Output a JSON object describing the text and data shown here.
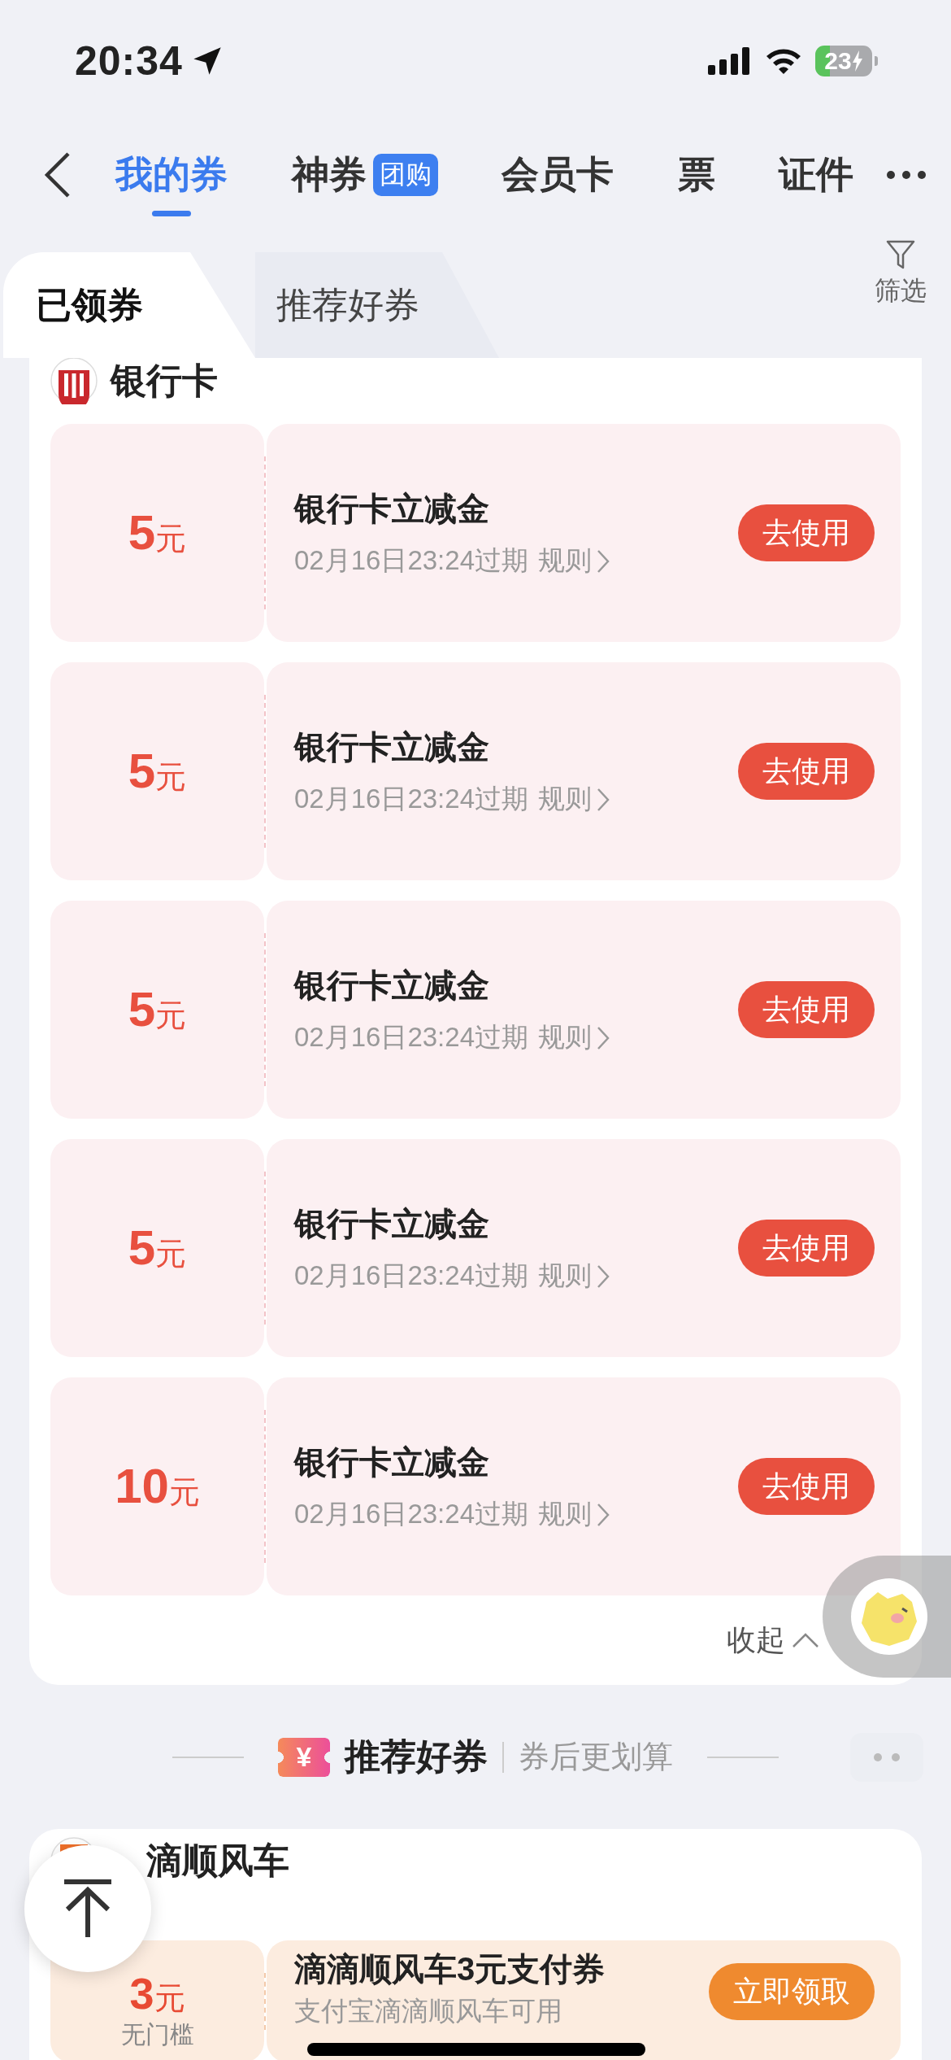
{
  "status_bar": {
    "time": "20:34",
    "battery": "23"
  },
  "nav": {
    "tabs": [
      {
        "label": "我的券",
        "selected": true
      },
      {
        "label": "神券",
        "selected": false,
        "badge": "团购"
      },
      {
        "label": "会员卡",
        "selected": false
      },
      {
        "label": "票",
        "selected": false
      },
      {
        "label": "证件",
        "selected": false
      }
    ]
  },
  "sub_tabs": {
    "tabs": [
      {
        "label": "已领券",
        "selected": true
      },
      {
        "label": "推荐好券",
        "selected": false
      }
    ],
    "filter": "筛选"
  },
  "groups": [
    {
      "name": "银行卡",
      "kind": "bank",
      "collapse": "收起",
      "coupons": [
        {
          "amount": "5",
          "unit": "元",
          "title": "银行卡立减金",
          "expiry": "02月16日23:24过期",
          "rules": "规则",
          "action": "去使用"
        },
        {
          "amount": "5",
          "unit": "元",
          "title": "银行卡立减金",
          "expiry": "02月16日23:24过期",
          "rules": "规则",
          "action": "去使用"
        },
        {
          "amount": "5",
          "unit": "元",
          "title": "银行卡立减金",
          "expiry": "02月16日23:24过期",
          "rules": "规则",
          "action": "去使用"
        },
        {
          "amount": "5",
          "unit": "元",
          "title": "银行卡立减金",
          "expiry": "02月16日23:24过期",
          "rules": "规则",
          "action": "去使用"
        },
        {
          "amount": "10",
          "unit": "元",
          "title": "银行卡立减金",
          "expiry": "02月16日23:24过期",
          "rules": "规则",
          "action": "去使用"
        }
      ]
    }
  ],
  "recommend": {
    "icon_text": "¥",
    "title": "推荐好券",
    "subtitle": "券后更划算"
  },
  "rec_groups": [
    {
      "name": "滴顺风车",
      "kind": "didi",
      "coupons": [
        {
          "amount": "3",
          "unit": "元",
          "condition": "无门槛",
          "title": "滴滴顺风车3元支付券",
          "expiry": "支付宝滴滴顺风车可用",
          "action": "立即领取"
        }
      ]
    }
  ]
}
